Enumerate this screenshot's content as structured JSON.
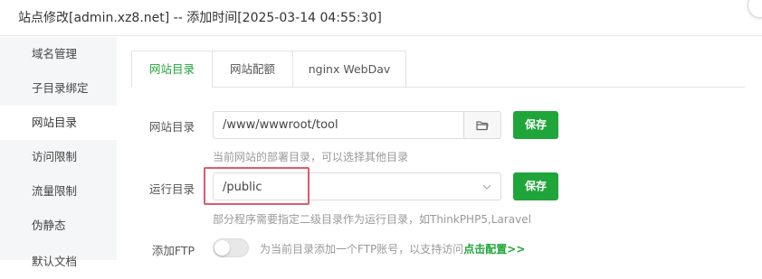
{
  "dialog": {
    "title": "站点修改[admin.xz8.net] -- 添加时间[2025-03-14 04:55:30]"
  },
  "sidebar": {
    "items": [
      {
        "label": "域名管理"
      },
      {
        "label": "子目录绑定"
      },
      {
        "label": "网站目录",
        "active": true
      },
      {
        "label": "访问限制"
      },
      {
        "label": "流量限制"
      },
      {
        "label": "伪静态"
      },
      {
        "label": "默认文档"
      }
    ]
  },
  "tabs": [
    {
      "label": "网站目录",
      "active": true
    },
    {
      "label": "网站配额"
    },
    {
      "label": "nginx WebDav"
    }
  ],
  "site_dir": {
    "label": "网站目录",
    "value": "/www/wwwroot/tool",
    "save_label": "保存",
    "hint": "当前网站的部署目录，可以选择其他目录"
  },
  "run_dir": {
    "label": "运行目录",
    "value": "/public",
    "save_label": "保存",
    "hint": "部分程序需要指定二级目录作为运行目录，如ThinkPHP5,Laravel"
  },
  "ftp": {
    "label": "添加FTP",
    "enabled": false,
    "hint": "为当前目录添加一个FTP账号，以支持访问",
    "link": "点击配置>>"
  },
  "colors": {
    "accent": "#20a53a",
    "highlight_border": "#e05a6b"
  },
  "icons": [
    "folder-icon",
    "chevron-down-icon",
    "close-icon"
  ]
}
